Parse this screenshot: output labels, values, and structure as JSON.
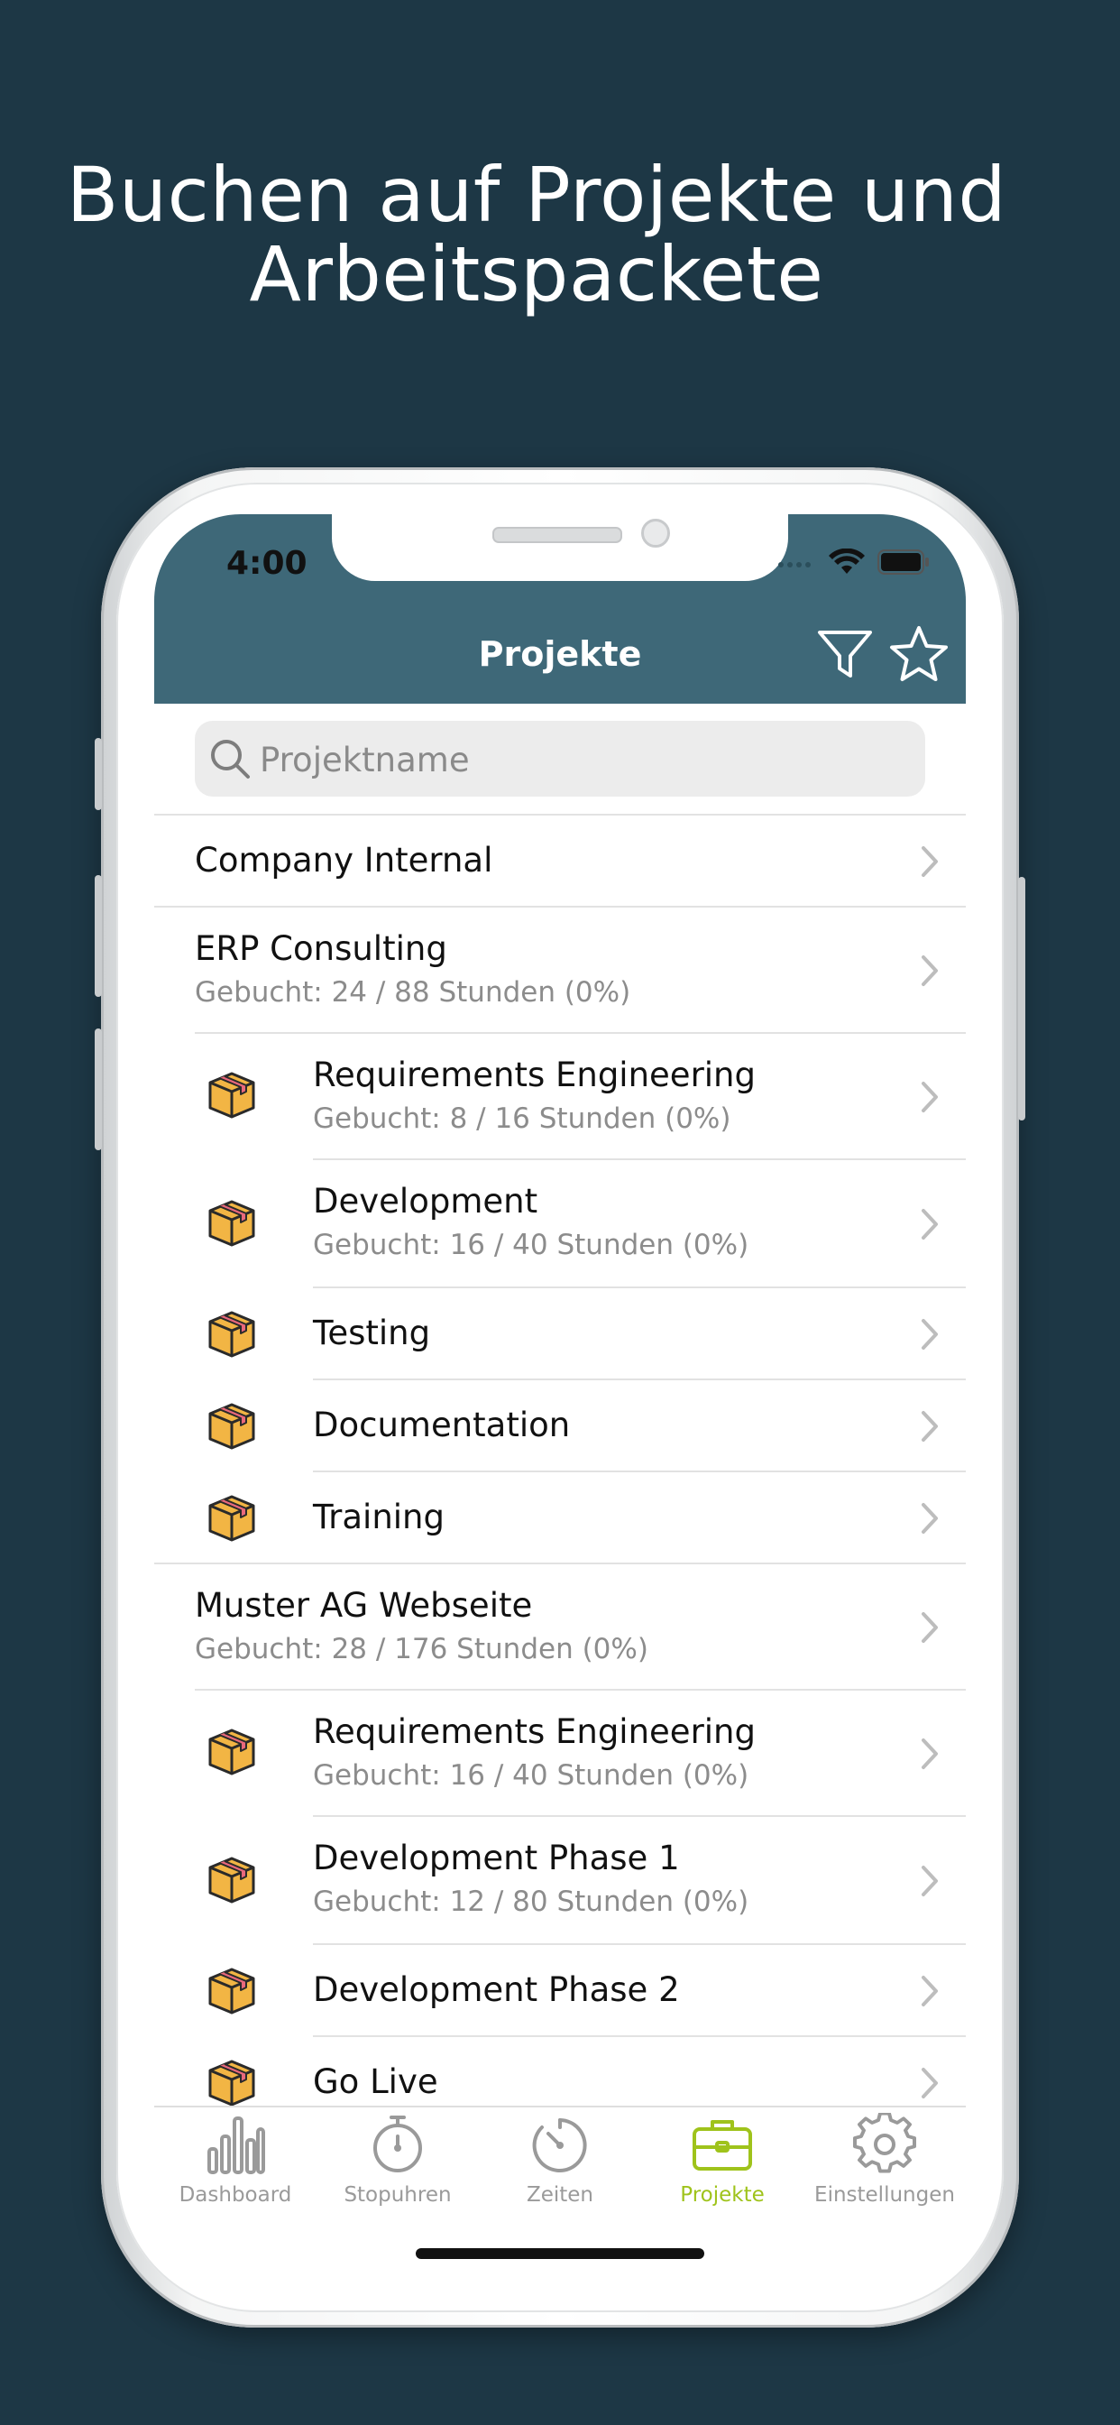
{
  "headline": {
    "line1": "Buchen auf Projekte und",
    "line2": "Arbeitspackete"
  },
  "status_bar": {
    "time": "4:00"
  },
  "navbar": {
    "title": "Projekte",
    "filter_icon": "filter-icon",
    "favorite_icon": "star-icon",
    "background": "#3e6878"
  },
  "search": {
    "placeholder": "Projektname",
    "value": ""
  },
  "list": {
    "rows": [
      {
        "title": "Company Internal",
        "subtitle": ""
      },
      {
        "title": "ERP Consulting",
        "subtitle": "Gebucht: 24 / 88 Stunden (0%)"
      },
      {
        "title": "Requirements Engineering",
        "subtitle": "Gebucht: 8 / 16 Stunden (0%)"
      },
      {
        "title": "Development",
        "subtitle": "Gebucht: 16 / 40 Stunden (0%)"
      },
      {
        "title": "Testing",
        "subtitle": ""
      },
      {
        "title": "Documentation",
        "subtitle": ""
      },
      {
        "title": "Training",
        "subtitle": ""
      },
      {
        "title": "Muster AG Webseite",
        "subtitle": "Gebucht: 28 / 176 Stunden (0%)"
      },
      {
        "title": "Requirements Engineering",
        "subtitle": "Gebucht: 16 / 40 Stunden (0%)"
      },
      {
        "title": "Development Phase 1",
        "subtitle": "Gebucht: 12 / 80 Stunden (0%)"
      },
      {
        "title": "Development Phase 2",
        "subtitle": ""
      },
      {
        "title": "Go Live",
        "subtitle": ""
      }
    ]
  },
  "tabbar": {
    "tabs": [
      {
        "label": "Dashboard",
        "icon": "bar-chart-icon"
      },
      {
        "label": "Stopuhren",
        "icon": "stopwatch-icon"
      },
      {
        "label": "Zeiten",
        "icon": "timer-icon"
      },
      {
        "label": "Projekte",
        "icon": "briefcase-icon",
        "active": true
      },
      {
        "label": "Einstellungen",
        "icon": "gear-icon"
      }
    ],
    "active_color": "#9fc31b",
    "inactive_color": "#9a9a9a"
  },
  "colors": {
    "page_background": "#1d3745",
    "work_package_icon": "#f2b544"
  }
}
